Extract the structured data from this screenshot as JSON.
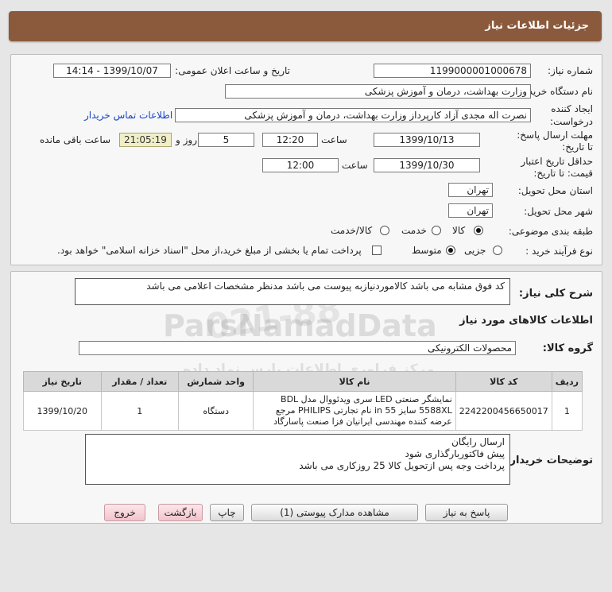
{
  "page": {
    "title": "جزئیات اطلاعات نیاز"
  },
  "info": {
    "need_number_label": "شماره نیاز:",
    "need_number": "1199000001000678",
    "announce_label": "تاریخ و ساعت اعلان عمومی:",
    "announce_value": "1399/10/07 - 14:14",
    "buyer_org_label": "نام دستگاه خریدار:",
    "buyer_org": "وزارت بهداشت، درمان و آموزش پزشکی",
    "creator_label_1": "ایجاد کننده",
    "creator_label_2": "درخواست:",
    "creator": "نصرت اله مجدی آزاد کارپرداز وزارت بهداشت، درمان و آموزش پزشکی",
    "contact_link": "اطلاعات تماس خریدار",
    "deadline_label_1": "مهلت ارسال پاسخ:",
    "deadline_label_2": "تا تاریخ:",
    "deadline_date": "1399/10/13",
    "time_label": "ساعت",
    "deadline_time": "12:20",
    "days_value": "5",
    "days_label": "روز و",
    "remaining_time": "21:05:19",
    "remaining_label": "ساعت باقی مانده",
    "validity_label_1": "حداقل تاریخ اعتبار",
    "validity_label_2": "قیمت: تا تاریخ:",
    "validity_date": "1399/10/30",
    "validity_time": "12:00",
    "province_label": "استان محل تحویل:",
    "province": "تهران",
    "city_label": "شهر محل تحویل:",
    "city": "تهران",
    "category_label": "طبقه بندی موضوعی:",
    "category_options": [
      "کالا",
      "خدمت",
      "کالا/خدمت"
    ],
    "process_label": "نوع فرآیند خرید :",
    "process_options": [
      "جزیی",
      "متوسط"
    ],
    "payment_note": "پرداخت تمام یا بخشی از مبلغ خرید،از محل \"اسناد خزانه اسلامی\" خواهد بود."
  },
  "description": {
    "label": "شرح کلی نیاز:",
    "text": "کد فوق مشابه می باشد کالامورد‌نیازبه پیوست می باشد مدنظر مشخصات اعلامی می باشد"
  },
  "goods": {
    "section_title": "اطلاعات کالاهای مورد نیاز",
    "group_label": "گروه کالا:",
    "group_value": "محصولات الکترونیکی",
    "columns": [
      "ردیف",
      "کد کالا",
      "نام کالا",
      "واحد شمارش",
      "تعداد / مقدار",
      "تاریخ نیاز"
    ],
    "rows": [
      {
        "row": "1",
        "code": "2242200456650017",
        "name": "نمایشگر صنعتی LED سری ویدئووال مدل BDL 5588XL سایز 55 in نام تجارتی PHILIPS مرجع عرضه کننده مهندسی ایرانیان فزا صنعت پاسارگاد",
        "unit": "دستگاه",
        "qty": "1",
        "date": "1399/10/20"
      }
    ]
  },
  "buyer_notes": {
    "label": "توضیحات خریدار:",
    "lines": [
      "ارسال رایگان",
      "پیش فاکتوربارگذاری شود",
      "پرداخت وجه پس ازتحویل کالا 25 روزکاری می باشد"
    ]
  },
  "buttons": {
    "reply": "پاسخ به نیاز",
    "attachments": "مشاهده مدارک پیوستی (1)",
    "print": "چاپ",
    "back": "بازگشت",
    "exit": "خروج"
  },
  "watermark": {
    "text": "ParsNamadData",
    "subtext": "مرکز فراوری اطلاعات پارس نماد داده",
    "digits": "021-88"
  }
}
